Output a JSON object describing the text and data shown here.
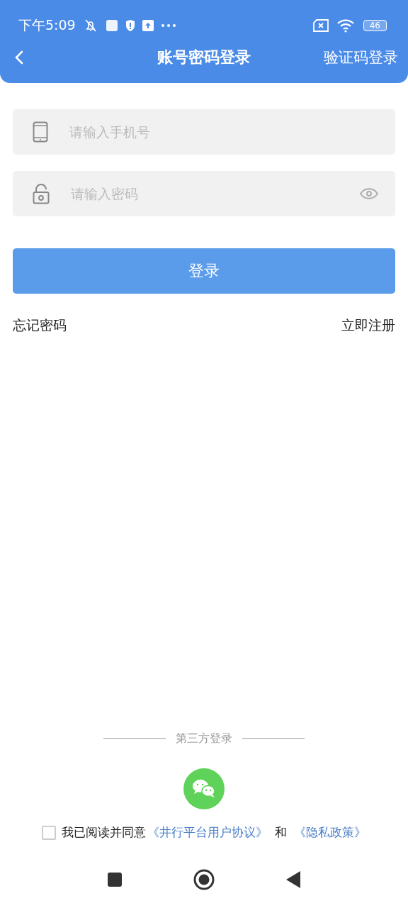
{
  "status_bar": {
    "time": "下午5:09",
    "battery": "46"
  },
  "header": {
    "title": "账号密码登录",
    "action": "验证码登录"
  },
  "fields": [
    {
      "kind": "phone",
      "placeholder": "请输入手机号"
    },
    {
      "kind": "password",
      "placeholder": "请输入密码"
    }
  ],
  "login_button": "登录",
  "links": {
    "forgot": "忘记密码",
    "register": "立即注册"
  },
  "third_party": {
    "label": "第三方登录"
  },
  "agreement": {
    "checked": false,
    "text": "我已阅读并同意",
    "terms": "《井行平台用户协议》",
    "and": "和",
    "privacy": "《隐私政策》"
  }
}
